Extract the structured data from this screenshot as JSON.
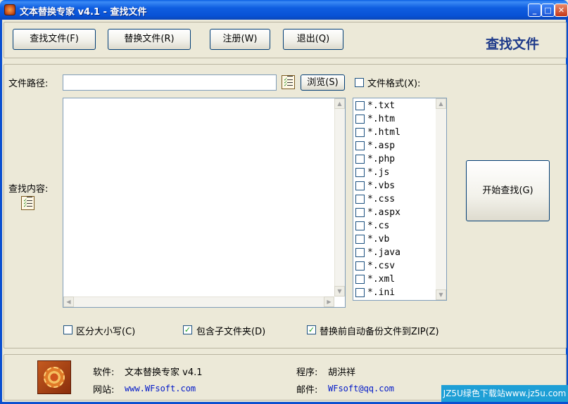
{
  "window": {
    "title": "文本替换专家 v4.1 - 查找文件",
    "minimize": "_",
    "maximize": "□",
    "close": "✕"
  },
  "toolbar": {
    "find_files": "查找文件(F)",
    "replace_files": "替换文件(R)",
    "register": "注册(W)",
    "exit": "退出(Q)",
    "section_title": "查找文件"
  },
  "form": {
    "path_label": "文件路径:",
    "path_value": "",
    "browse_button": "浏览(S)",
    "file_format_label": "文件格式(X):",
    "file_format_checked": false,
    "content_label": "查找内容:",
    "content_value": ""
  },
  "extensions": [
    {
      "label": "*.txt",
      "checked": false
    },
    {
      "label": "*.htm",
      "checked": false
    },
    {
      "label": "*.html",
      "checked": false
    },
    {
      "label": "*.asp",
      "checked": false
    },
    {
      "label": "*.php",
      "checked": false
    },
    {
      "label": "*.js",
      "checked": false
    },
    {
      "label": "*.vbs",
      "checked": false
    },
    {
      "label": "*.css",
      "checked": false
    },
    {
      "label": "*.aspx",
      "checked": false
    },
    {
      "label": "*.cs",
      "checked": false
    },
    {
      "label": "*.vb",
      "checked": false
    },
    {
      "label": "*.java",
      "checked": false
    },
    {
      "label": "*.csv",
      "checked": false
    },
    {
      "label": "*.xml",
      "checked": false
    },
    {
      "label": "*.ini",
      "checked": false
    }
  ],
  "start_button": "开始查找(G)",
  "options": {
    "case_sensitive": {
      "label": "区分大小写(C)",
      "checked": false
    },
    "include_subfolders": {
      "label": "包含子文件夹(D)",
      "checked": true
    },
    "backup_zip": {
      "label": "替换前自动备份文件到ZIP(Z)",
      "checked": true
    }
  },
  "footer": {
    "software_label": "软件:",
    "software_value": "文本替换专家 v4.1",
    "website_label": "网站:",
    "website_value": "www.WFsoft.com",
    "author_label": "程序:",
    "author_value": "胡洪祥",
    "email_label": "邮件:",
    "email_value": "WFsoft@qq.com"
  },
  "watermark": "JZ5U绿色下载站www.jz5u.com",
  "icons": {
    "check": "✓",
    "scroll_up": "▲",
    "scroll_down": "▼",
    "scroll_left": "◀",
    "scroll_right": "▶"
  }
}
